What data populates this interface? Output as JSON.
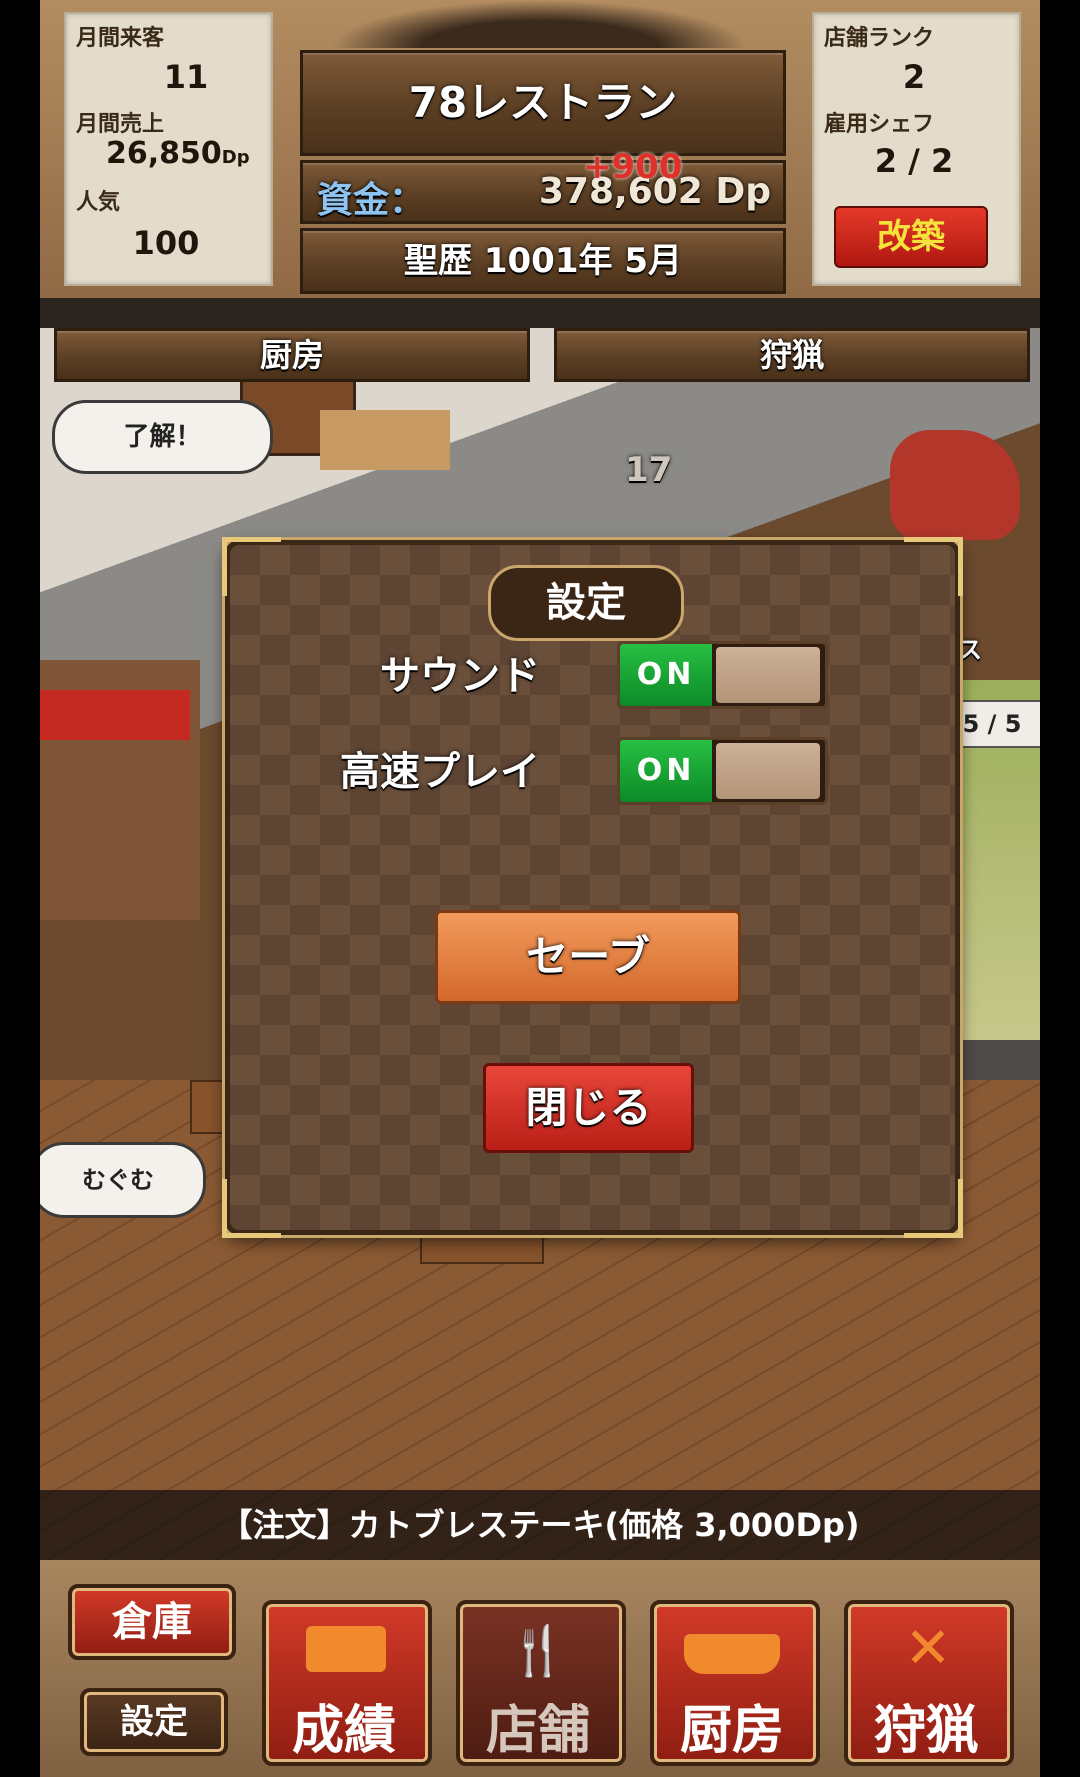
{
  "hud": {
    "monthly_visitors_label": "月間来客",
    "monthly_visitors_value": "11",
    "monthly_sales_label": "月間売上",
    "monthly_sales_value": "26,850",
    "monthly_sales_unit": "Dp",
    "popularity_label": "人気",
    "popularity_value": "100",
    "restaurant_name": "78レストラン",
    "funds_label": "資金：",
    "funds_value": "378,602 Dp",
    "funds_delta": "+900",
    "date": "聖歴 1001年 5月",
    "store_rank_label": "店舗ランク",
    "store_rank_value": "2",
    "hired_chefs_label": "雇用シェフ",
    "hired_chefs_value": "2 / 2",
    "renovate_label": "改築"
  },
  "tabs": {
    "kitchen": "厨房",
    "hunting": "狩猟"
  },
  "scene": {
    "speech_bubble_1": "了解！",
    "speech_bubble_2": "むぐむ",
    "damage_number": "17",
    "monster_name_partial": "ルパス",
    "hunting_count": "5 / 5"
  },
  "dialog": {
    "title": "設定",
    "sound_label": "サウンド",
    "sound_state": "ON",
    "fast_play_label": "高速プレイ",
    "fast_play_state": "ON",
    "save_label": "セーブ",
    "close_label": "閉じる"
  },
  "order_ticker": "【注文】カトブレステーキ(価格 3,000Dp)",
  "bottom_nav": {
    "storage": "倉庫",
    "settings": "設定",
    "results": "成績",
    "store": "店舗",
    "kitchen": "厨房",
    "hunting": "狩猟"
  },
  "colors": {
    "toggle_on": "#1fa83a",
    "save_button": "#e07b3a",
    "close_button": "#d9322a",
    "renovate_button": "#d42a1e",
    "renovate_text": "#f5e23b",
    "funds_delta": "#e0302a"
  }
}
